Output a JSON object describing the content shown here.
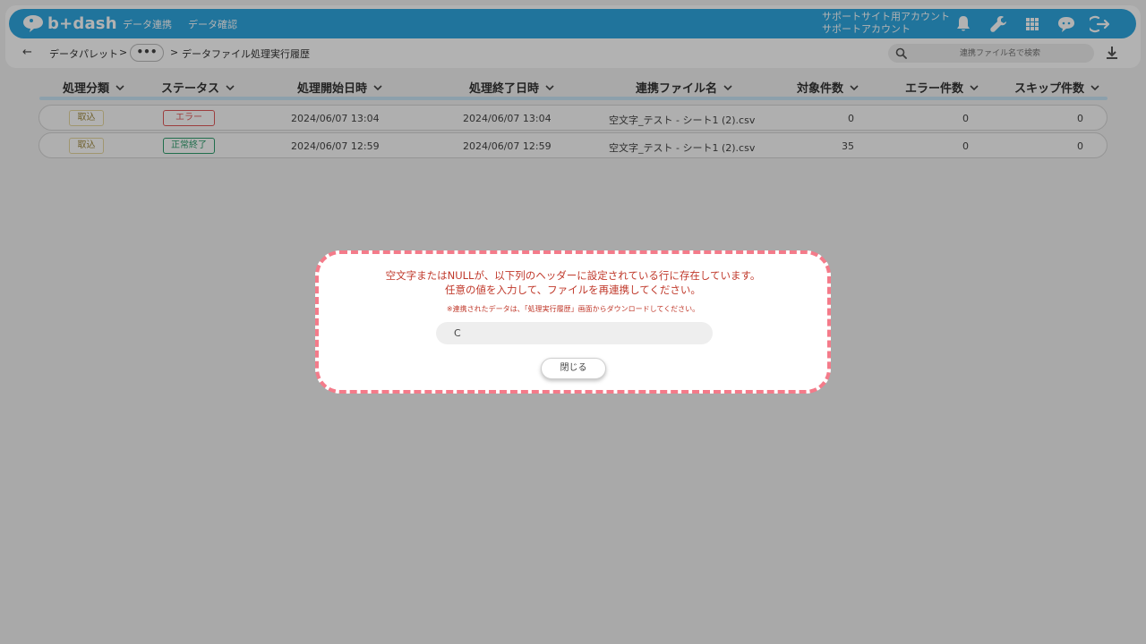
{
  "app": {
    "logo_text": "b+dash"
  },
  "nav": {
    "links": [
      "データ連携",
      "データ確認"
    ],
    "account_line1": "サポートサイト用アカウント",
    "account_line2": "サポートアカウント",
    "icons": [
      "bell-icon",
      "wrench-icon",
      "grid-icon",
      "chat-icon",
      "logout-icon"
    ],
    "brand_color": "#2ea7e0"
  },
  "breadcrumb": {
    "back_icon": "←",
    "items": [
      "データパレット",
      "•••",
      "データファイル処理実行履歴"
    ],
    "separator": ">"
  },
  "search": {
    "placeholder": "連携ファイル名で検索"
  },
  "table": {
    "headers": [
      "処理分類",
      "ステータス",
      "処理開始日時",
      "処理終了日時",
      "連携ファイル名",
      "対象件数",
      "エラー件数",
      "スキップ件数"
    ],
    "rows": [
      {
        "category": "取込",
        "status": "エラー",
        "status_color": "#e05a5a",
        "start": "2024/06/07 13:04",
        "end": "2024/06/07 13:04",
        "file": "空文字_テスト - シート1 (2).csv",
        "target": "0",
        "errors": "0",
        "skips": "0"
      },
      {
        "category": "取込",
        "status": "正常終了",
        "status_color": "#2f9e6e",
        "start": "2024/06/07 12:59",
        "end": "2024/06/07 12:59",
        "file": "空文字_テスト - シート1 (2).csv",
        "target": "35",
        "errors": "0",
        "skips": "0"
      }
    ]
  },
  "modal": {
    "message_line1": "空文字またはNULLが、以下列のヘッダーに設定されている行に存在しています。",
    "message_line2": "任意の値を入力して、ファイルを再連携してください。",
    "note": "※連携されたデータは、「処理実行履歴」画面からダウンロードしてください。",
    "field_value": "C",
    "close_label": "閉じる",
    "border_color": "#f47b8a"
  }
}
